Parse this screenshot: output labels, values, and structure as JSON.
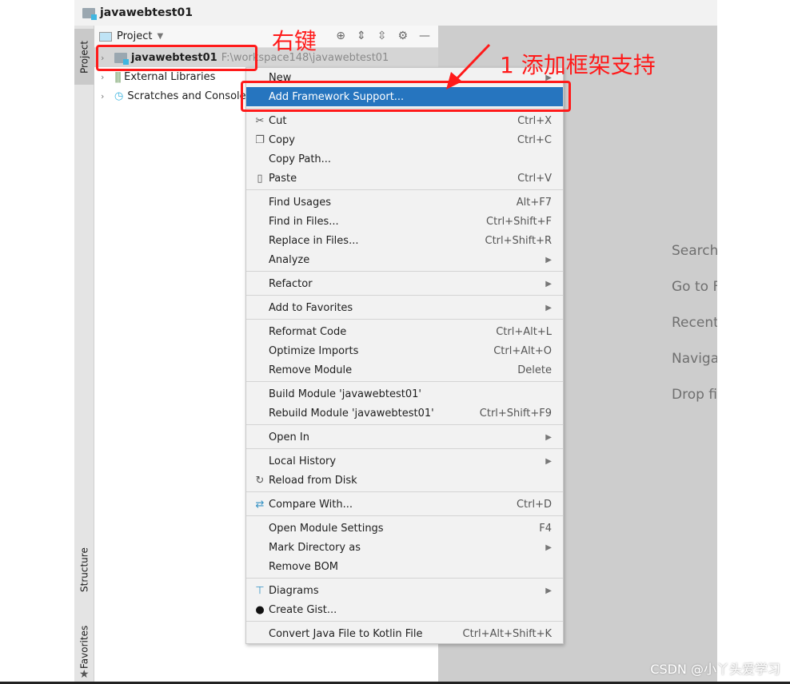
{
  "window": {
    "title": "javawebtest01"
  },
  "stripe": {
    "project": "Project",
    "structure": "Structure",
    "favorites": "Favorites"
  },
  "panel": {
    "header": "Project",
    "tree": [
      {
        "label": "javawebtest01",
        "path": "F:\\workspace148\\javawebtest01"
      },
      {
        "label": "External Libraries"
      },
      {
        "label": "Scratches and Consoles"
      }
    ]
  },
  "editor": {
    "hints": [
      "Search Everywhere",
      "Go to File",
      "Recent Files",
      "Navigation Bar",
      "Drop files here to open"
    ]
  },
  "menu": [
    {
      "label": "New",
      "arrow": true
    },
    {
      "label": "Add Framework Support...",
      "highlighted": true
    },
    {
      "sep": true
    },
    {
      "label": "Cut",
      "shortcut": "Ctrl+X",
      "icon": "scissors-icon"
    },
    {
      "label": "Copy",
      "shortcut": "Ctrl+C",
      "icon": "copy-icon"
    },
    {
      "label": "Copy Path..."
    },
    {
      "label": "Paste",
      "shortcut": "Ctrl+V",
      "icon": "paste-icon"
    },
    {
      "sep": true
    },
    {
      "label": "Find Usages",
      "shortcut": "Alt+F7"
    },
    {
      "label": "Find in Files...",
      "shortcut": "Ctrl+Shift+F"
    },
    {
      "label": "Replace in Files...",
      "shortcut": "Ctrl+Shift+R"
    },
    {
      "label": "Analyze",
      "arrow": true
    },
    {
      "sep": true
    },
    {
      "label": "Refactor",
      "arrow": true
    },
    {
      "sep": true
    },
    {
      "label": "Add to Favorites",
      "arrow": true
    },
    {
      "sep": true
    },
    {
      "label": "Reformat Code",
      "shortcut": "Ctrl+Alt+L"
    },
    {
      "label": "Optimize Imports",
      "shortcut": "Ctrl+Alt+O"
    },
    {
      "label": "Remove Module",
      "shortcut": "Delete"
    },
    {
      "sep": true
    },
    {
      "label": "Build Module 'javawebtest01'"
    },
    {
      "label": "Rebuild Module 'javawebtest01'",
      "shortcut": "Ctrl+Shift+F9"
    },
    {
      "sep": true
    },
    {
      "label": "Open In",
      "arrow": true
    },
    {
      "sep": true
    },
    {
      "label": "Local History",
      "arrow": true
    },
    {
      "label": "Reload from Disk",
      "icon": "reload-icon"
    },
    {
      "sep": true
    },
    {
      "label": "Compare With...",
      "shortcut": "Ctrl+D",
      "icon": "compare-icon"
    },
    {
      "sep": true
    },
    {
      "label": "Open Module Settings",
      "shortcut": "F4"
    },
    {
      "label": "Mark Directory as",
      "arrow": true
    },
    {
      "label": "Remove BOM"
    },
    {
      "sep": true
    },
    {
      "label": "Diagrams",
      "arrow": true,
      "icon": "diagram-icon"
    },
    {
      "label": "Create Gist...",
      "icon": "github-icon"
    },
    {
      "sep": true
    },
    {
      "label": "Convert Java File to Kotlin File",
      "shortcut": "Ctrl+Alt+Shift+K"
    }
  ],
  "annotations": {
    "right_click": "右键",
    "step1": "1 添加框架支持",
    "color": "#ff1a1a"
  },
  "watermark": "CSDN @小丫头爱学习"
}
